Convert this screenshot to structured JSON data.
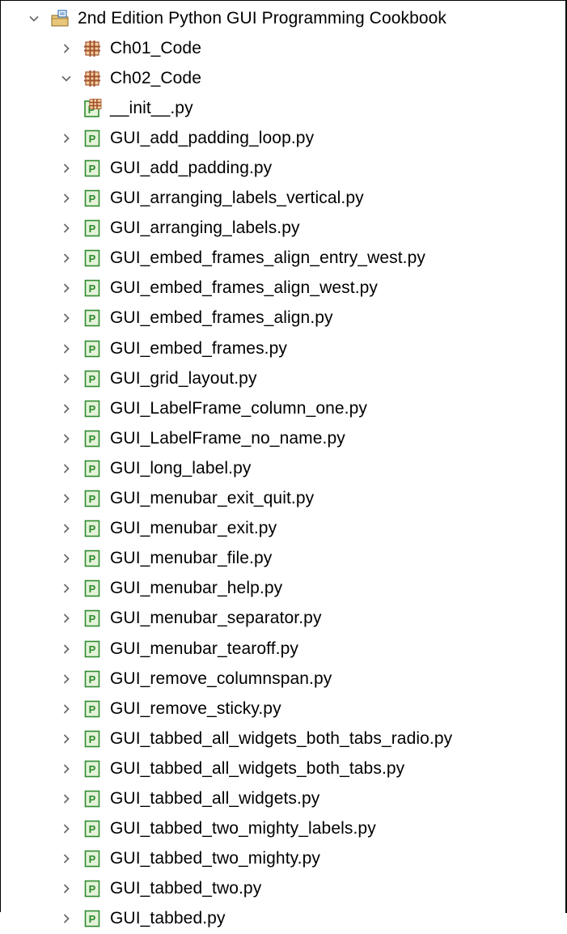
{
  "project": {
    "label": "2nd Edition Python GUI Programming Cookbook",
    "icon": "project-folder-icon",
    "expanded": true
  },
  "packages": [
    {
      "label": "Ch01_Code",
      "icon": "package-icon",
      "expanded": false
    },
    {
      "label": "Ch02_Code",
      "icon": "package-icon",
      "expanded": true
    }
  ],
  "ch02_files": [
    {
      "label": "__init__.py",
      "icon": "python-init-icon",
      "expandable": false
    },
    {
      "label": "GUI_add_padding_loop.py",
      "icon": "python-file-icon",
      "expandable": true
    },
    {
      "label": "GUI_add_padding.py",
      "icon": "python-file-icon",
      "expandable": true
    },
    {
      "label": "GUI_arranging_labels_vertical.py",
      "icon": "python-file-icon",
      "expandable": true
    },
    {
      "label": "GUI_arranging_labels.py",
      "icon": "python-file-icon",
      "expandable": true
    },
    {
      "label": "GUI_embed_frames_align_entry_west.py",
      "icon": "python-file-icon",
      "expandable": true
    },
    {
      "label": "GUI_embed_frames_align_west.py",
      "icon": "python-file-icon",
      "expandable": true
    },
    {
      "label": "GUI_embed_frames_align.py",
      "icon": "python-file-icon",
      "expandable": true
    },
    {
      "label": "GUI_embed_frames.py",
      "icon": "python-file-icon",
      "expandable": true
    },
    {
      "label": "GUI_grid_layout.py",
      "icon": "python-file-icon",
      "expandable": true
    },
    {
      "label": "GUI_LabelFrame_column_one.py",
      "icon": "python-file-icon",
      "expandable": true
    },
    {
      "label": "GUI_LabelFrame_no_name.py",
      "icon": "python-file-icon",
      "expandable": true
    },
    {
      "label": "GUI_long_label.py",
      "icon": "python-file-icon",
      "expandable": true
    },
    {
      "label": "GUI_menubar_exit_quit.py",
      "icon": "python-file-icon",
      "expandable": true
    },
    {
      "label": "GUI_menubar_exit.py",
      "icon": "python-file-icon",
      "expandable": true
    },
    {
      "label": "GUI_menubar_file.py",
      "icon": "python-file-icon",
      "expandable": true
    },
    {
      "label": "GUI_menubar_help.py",
      "icon": "python-file-icon",
      "expandable": true
    },
    {
      "label": "GUI_menubar_separator.py",
      "icon": "python-file-icon",
      "expandable": true
    },
    {
      "label": "GUI_menubar_tearoff.py",
      "icon": "python-file-icon",
      "expandable": true
    },
    {
      "label": "GUI_remove_columnspan.py",
      "icon": "python-file-icon",
      "expandable": true
    },
    {
      "label": "GUI_remove_sticky.py",
      "icon": "python-file-icon",
      "expandable": true
    },
    {
      "label": "GUI_tabbed_all_widgets_both_tabs_radio.py",
      "icon": "python-file-icon",
      "expandable": true
    },
    {
      "label": "GUI_tabbed_all_widgets_both_tabs.py",
      "icon": "python-file-icon",
      "expandable": true
    },
    {
      "label": "GUI_tabbed_all_widgets.py",
      "icon": "python-file-icon",
      "expandable": true
    },
    {
      "label": "GUI_tabbed_two_mighty_labels.py",
      "icon": "python-file-icon",
      "expandable": true
    },
    {
      "label": "GUI_tabbed_two_mighty.py",
      "icon": "python-file-icon",
      "expandable": true
    },
    {
      "label": "GUI_tabbed_two.py",
      "icon": "python-file-icon",
      "expandable": true
    },
    {
      "label": "GUI_tabbed.py",
      "icon": "python-file-icon",
      "expandable": true
    }
  ],
  "colors": {
    "package_brown": "#a0522d",
    "package_bg": "#f5cfa0",
    "python_green": "#2e8b2e",
    "python_bg": "#e4f3d9",
    "chevron": "#6b6b6b",
    "project_blue": "#2f6db5"
  }
}
